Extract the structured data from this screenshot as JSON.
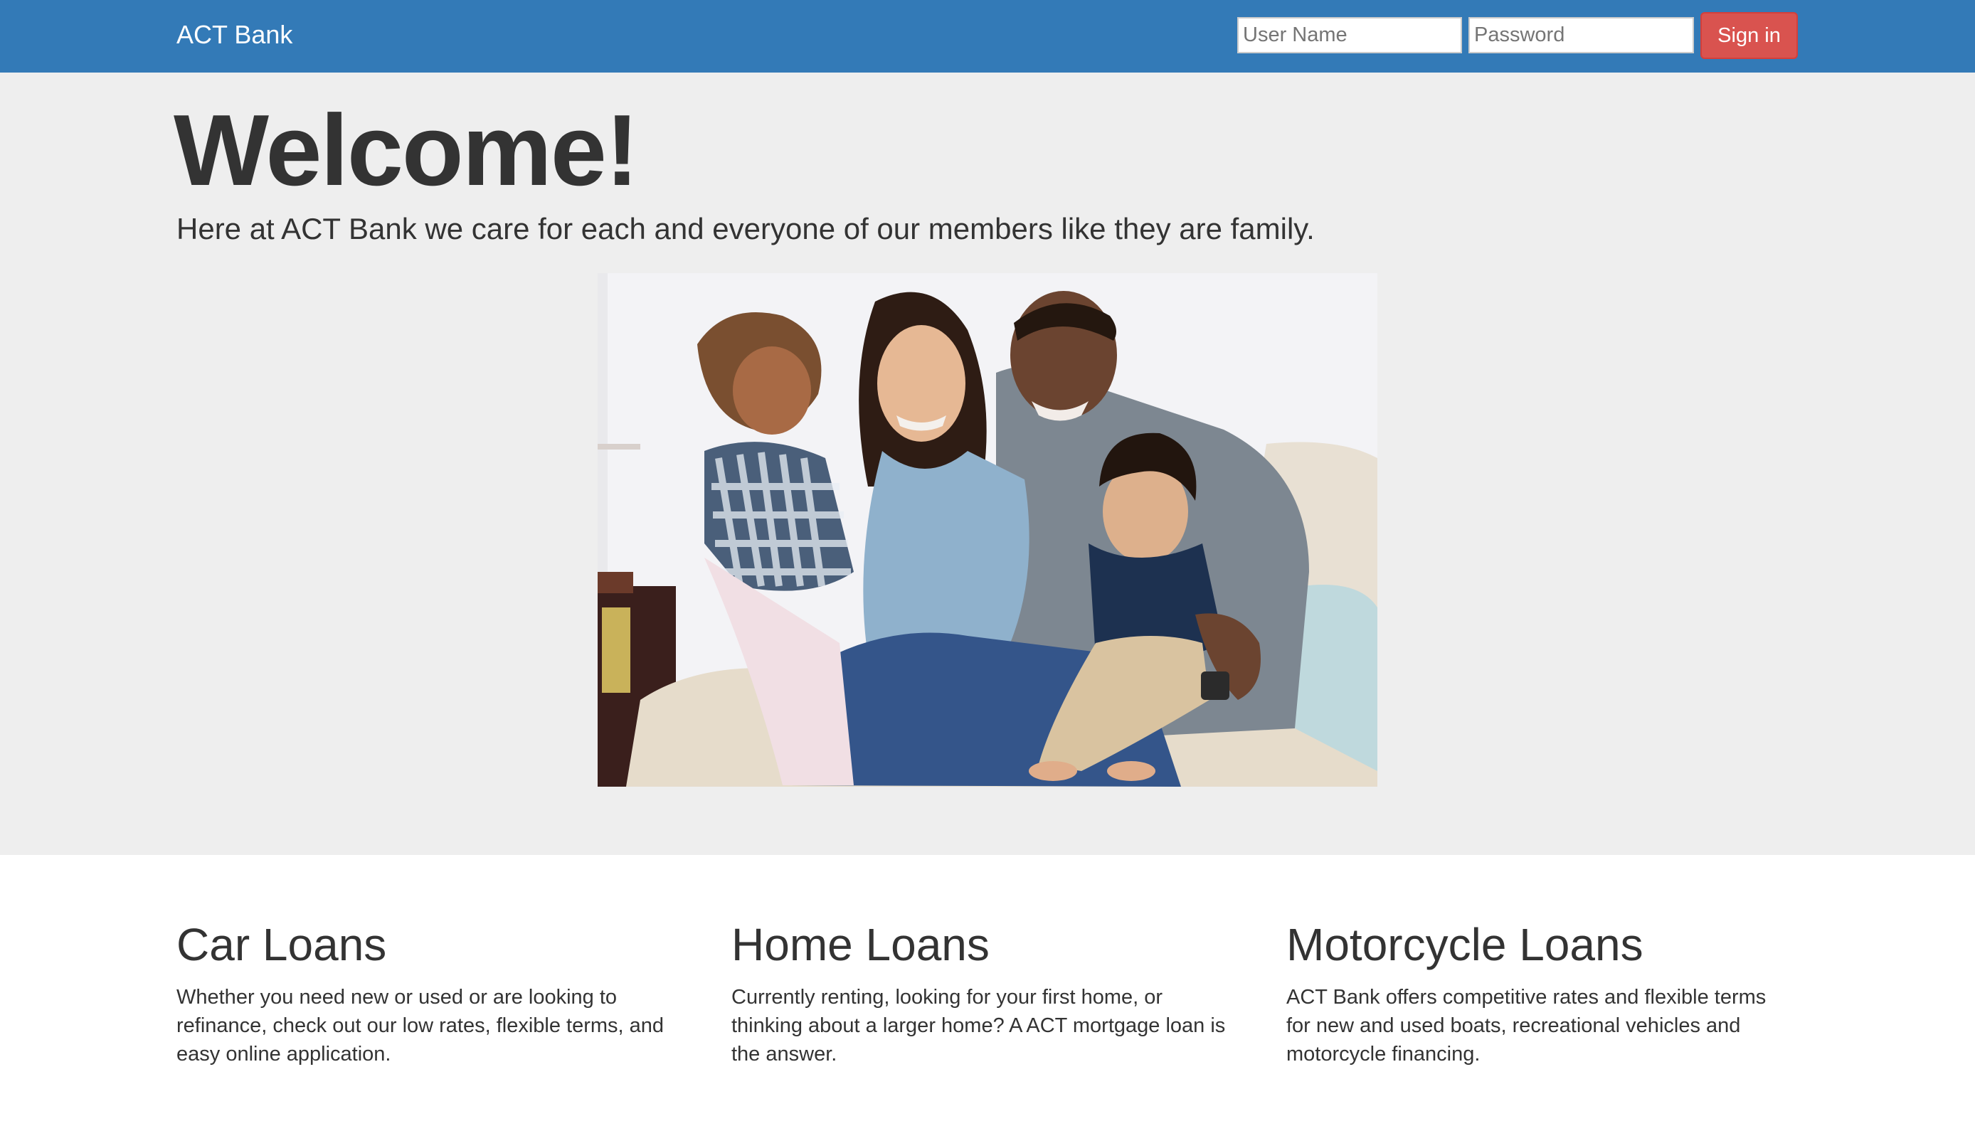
{
  "navbar": {
    "brand": "ACT Bank",
    "username_placeholder": "User Name",
    "password_placeholder": "Password",
    "signin_label": "Sign in"
  },
  "jumbotron": {
    "heading": "Welcome!",
    "lead": "Here at ACT Bank we care for each and everyone of our members like they are family."
  },
  "features": [
    {
      "title": "Car Loans",
      "text": "Whether you need new or used or are looking to refinance, check out our low rates, flexible terms, and easy online application."
    },
    {
      "title": "Home Loans",
      "text": "Currently renting, looking for your first home, or thinking about a larger home? A ACT mortgage loan is the answer."
    },
    {
      "title": "Motorcycle Loans",
      "text": "ACT Bank offers competitive rates and flexible terms for new and used boats, recreational vehicles and motorcycle financing."
    }
  ],
  "colors": {
    "navbar": "#337ab7",
    "signin": "#d9534f",
    "jumbotron": "#eeeeee",
    "text": "#333333"
  }
}
